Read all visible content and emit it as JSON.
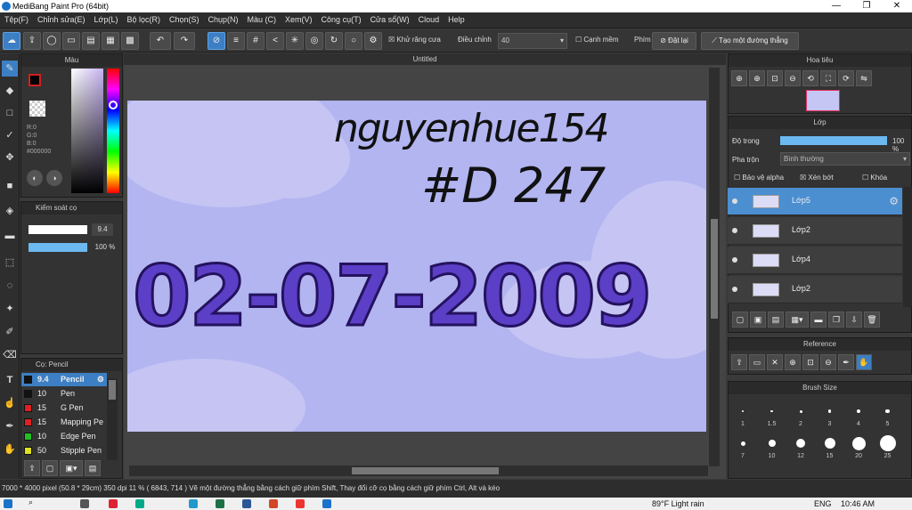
{
  "app": {
    "title": "MediBang Paint Pro (64bit)"
  },
  "menu": [
    "Tệp(F)",
    "Chỉnh sửa(E)",
    "Lớp(L)",
    "Bộ lọc(R)",
    "Chọn(S)",
    "Chụp(N)",
    "Màu (C)",
    "Xem(V)",
    "Công cụ(T)",
    "Cửa sổ(W)",
    "Cloud",
    "Help"
  ],
  "toolbar": {
    "antialias": "Khử răng cưa",
    "correction_label": "Điều chỉnh",
    "correction_value": "40",
    "soft_edge": "Cạnh mềm",
    "key_label": "Phím",
    "reset": "Đặt lại",
    "make_line": "Tạo một đường thẳng"
  },
  "color_panel": {
    "title": "Màu",
    "r": "R:0",
    "g": "G:0",
    "b": "B:0",
    "hex": "#000000"
  },
  "brush_control": {
    "title": "Kiểm soát cọ",
    "size": "9.4",
    "opacity": "100 %"
  },
  "brush_panel": {
    "title": "Cọ: Pencil",
    "items": [
      {
        "size": "9.4",
        "name": "Pencil",
        "color": "#111111",
        "selected": true
      },
      {
        "size": "10",
        "name": "Pen",
        "color": "#111111",
        "selected": false
      },
      {
        "size": "15",
        "name": "G Pen",
        "color": "#e02020",
        "selected": false
      },
      {
        "size": "15",
        "name": "Mapping Pe",
        "color": "#e02020",
        "selected": false
      },
      {
        "size": "10",
        "name": "Edge Pen",
        "color": "#20c020",
        "selected": false
      },
      {
        "size": "50",
        "name": "Stipple Pen",
        "color": "#e0e020",
        "selected": false
      }
    ]
  },
  "document": {
    "tab": "Untitled",
    "canvas_text": {
      "top": "nguyenhue154",
      "middle": "#D 247",
      "date": "02-07-2009"
    }
  },
  "navigator": {
    "title": "Hoa tiêu"
  },
  "layers": {
    "title": "Lớp",
    "opacity_label": "Độ trong",
    "opacity_value": "100 %",
    "blend_label": "Pha trộn",
    "blend_value": "Bình thường",
    "protect_alpha": "Bảo vệ alpha",
    "clipping": "Xén bớt",
    "lock": "Khóa",
    "items": [
      {
        "name": "Lớp5",
        "selected": true
      },
      {
        "name": "Lớp2",
        "selected": false
      },
      {
        "name": "Lớp4",
        "selected": false
      },
      {
        "name": "Lớp2",
        "selected": false
      }
    ]
  },
  "reference": {
    "title": "Reference"
  },
  "brush_size": {
    "title": "Brush Size",
    "sizes": [
      "1",
      "1.5",
      "2",
      "3",
      "4",
      "5",
      "7",
      "10",
      "12",
      "15",
      "20",
      "25"
    ]
  },
  "status": {
    "text": "7000 * 4000 pixel   (50.8 * 29cm)   350 dpi   11 %   ( 6843, 714 )   Vẽ một đường thẳng bằng cách giữ phím Shift, Thay đổi cỡ cọ bằng cách giữ phím Ctrl, Alt và kéo"
  },
  "taskbar": {
    "weather": "89°F  Light rain",
    "lang": "ENG",
    "time": "10:46 AM"
  }
}
